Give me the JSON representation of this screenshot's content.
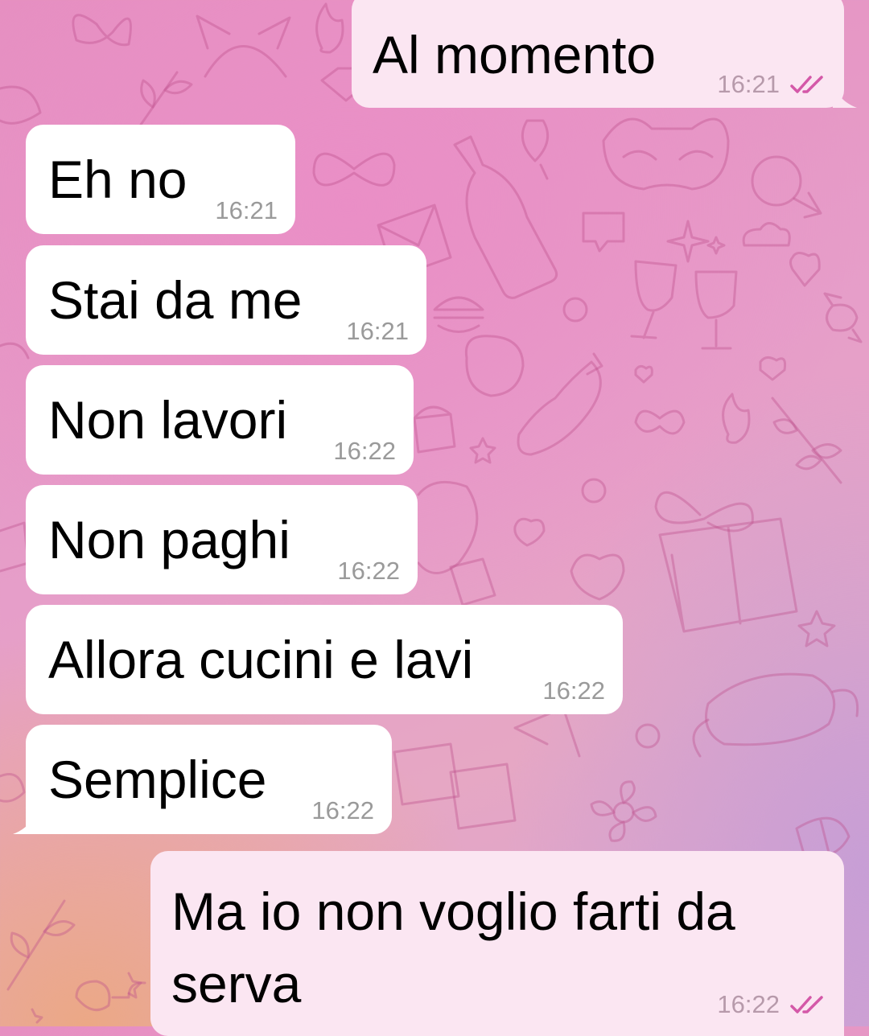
{
  "colors": {
    "incoming_bubble": "#ffffff",
    "outgoing_bubble": "#fbe6f2",
    "read_ticks": "#d458a8",
    "timestamp": "#9a9a9a"
  },
  "messages": [
    {
      "direction": "out",
      "text": "Al momento",
      "time": "16:21",
      "status_icon": "double-check-icon"
    },
    {
      "direction": "in",
      "text": "Eh no",
      "time": "16:21"
    },
    {
      "direction": "in",
      "text": "Stai da me",
      "time": "16:21"
    },
    {
      "direction": "in",
      "text": "Non lavori",
      "time": "16:22"
    },
    {
      "direction": "in",
      "text": "Non paghi",
      "time": "16:22"
    },
    {
      "direction": "in",
      "text": "Allora cucini e lavi",
      "time": "16:22"
    },
    {
      "direction": "in",
      "text": "Semplice",
      "time": "16:22"
    },
    {
      "direction": "out",
      "text": "Ma io non voglio farti da serva",
      "time": "16:22",
      "status_icon": "double-check-icon"
    }
  ]
}
